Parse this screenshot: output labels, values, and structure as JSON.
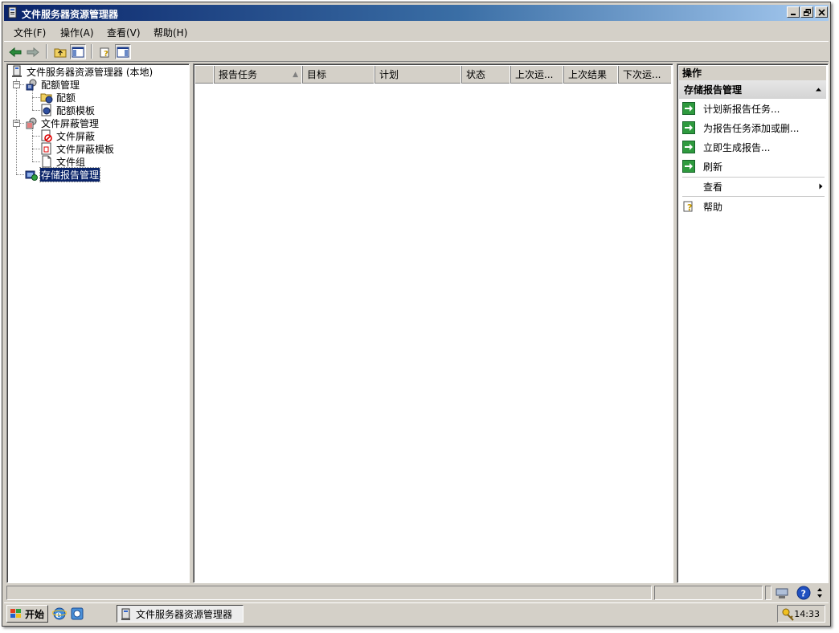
{
  "window": {
    "title": "文件服务器资源管理器"
  },
  "menubar": {
    "items": [
      "文件(F)",
      "操作(A)",
      "查看(V)",
      "帮助(H)"
    ]
  },
  "tree": {
    "root": "文件服务器资源管理器 (本地)",
    "quota": {
      "label": "配额管理",
      "children": [
        "配额",
        "配额模板"
      ]
    },
    "screening": {
      "label": "文件屏蔽管理",
      "children": [
        "文件屏蔽",
        "文件屏蔽模板",
        "文件组"
      ]
    },
    "reports": {
      "label": "存储报告管理",
      "selected": true
    }
  },
  "list": {
    "columns": [
      "报告任务",
      "目标",
      "计划",
      "状态",
      "上次运...",
      "上次结果",
      "下次运..."
    ],
    "sort_indicator": "▲",
    "rows": []
  },
  "actions": {
    "header": "操作",
    "section_title": "存储报告管理",
    "items": [
      "计划新报告任务...",
      "为报告任务添加或删...",
      "立即生成报告..."
    ],
    "refresh": "刷新",
    "view": "查看",
    "help": "帮助"
  },
  "taskbar": {
    "start_label": "开始",
    "app_button": "文件服务器资源管理器",
    "clock": "14:33"
  },
  "colors": {
    "titlebar_start": "#0a246a",
    "titlebar_end": "#a6caf0",
    "selection": "#0a246a",
    "face": "#d4d0c8"
  }
}
